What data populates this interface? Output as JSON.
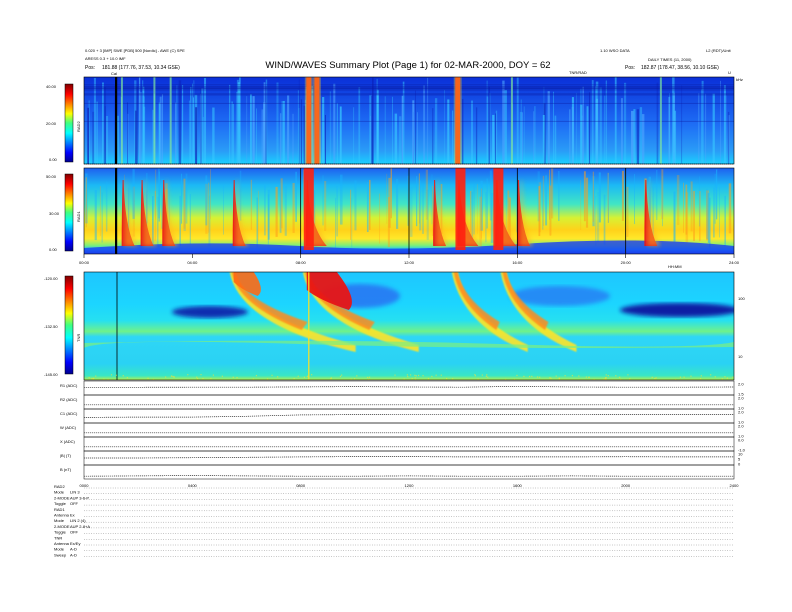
{
  "header": {
    "left_line1": "0.020 + 3 [IMP] SWE [PDB] 500 [Nordic] - AWE (C) SPE",
    "left_line2": "ARESS 0.3 + 10.0 IMF",
    "left_pos_label": "Pos:",
    "left_pos_value": "181.88 (177.76, 37.53, 10.34 GSE)",
    "title": "WIND/WAVES Summary Plot (Page 1) for 02-MAR-2000, DOY = 62",
    "right_line1": "1.10 WSO DATA",
    "right_line1b": "L2 (RDT)/Unit",
    "right_line2": "DAILY TIMES (11, 2000)",
    "right_pos_label": "Pos:",
    "right_pos_value": "182.87 (178.47, 38.56, 10.10 GSE)",
    "cal_label": "Cal",
    "tnr_top_label": "TNR/RAD"
  },
  "chart_data": [
    {
      "type": "heatmap",
      "panel": "RAD2",
      "ylabel": "RAD2",
      "y_ticks": [
        "40.00",
        "20.00",
        "0.00"
      ],
      "ylim": [
        0,
        40
      ],
      "right_label": "kHz",
      "right_top_label": "U",
      "color_scale": "jet",
      "xlim": [
        0,
        24
      ],
      "events_hours": [
        1.4,
        2.6,
        3.2,
        8.3,
        8.6,
        13.8,
        15.8,
        21.3
      ]
    },
    {
      "type": "heatmap",
      "panel": "RAD1",
      "ylabel": "RAD1",
      "y_ticks": [
        "50.00",
        "30.00",
        "0.00"
      ],
      "ylim": [
        0,
        50
      ],
      "color_scale": "jet",
      "xlim": [
        0,
        24
      ],
      "x_ticks": [
        "00:00",
        "04:00",
        "08:00",
        "12:00",
        "16:00",
        "20:00",
        "24:00"
      ],
      "x_axis_right_label": "HH:MM",
      "events_hours": [
        1.5,
        2.2,
        3.0,
        5.6,
        8.3,
        13.0,
        13.9,
        15.3,
        16.1,
        20.8
      ]
    },
    {
      "type": "heatmap",
      "panel": "TNR",
      "ylabel": "TNR",
      "y_ticks": [
        "-120.00",
        "-132.50",
        "-145.00"
      ],
      "ylim": [
        -145,
        -120
      ],
      "right_ticks": [
        "100",
        "10"
      ],
      "color_scale": "jet",
      "xlim": [
        0,
        24
      ],
      "events_hours": [
        5.6,
        8.3,
        13.8,
        15.6
      ]
    },
    {
      "type": "line",
      "panel": "stack",
      "series": [
        {
          "name": "R1 (ADC)",
          "ticks": [
            "2.0",
            "1.5"
          ],
          "values": [
            0.55,
            0.55,
            0.56,
            0.56,
            0.58,
            0.6,
            0.57,
            0.56,
            0.62,
            0.57,
            0.56,
            0.56,
            0.57
          ]
        },
        {
          "name": "R2 (ADC)",
          "ticks": [
            "2.0",
            "1.0"
          ],
          "values": [
            0.3,
            0.3,
            0.3,
            0.3,
            0.3,
            0.3,
            0.3,
            0.3,
            0.3,
            0.3,
            0.3,
            0.3,
            0.3
          ]
        },
        {
          "name": "C1 (ADC)",
          "ticks": [
            "2.0",
            "1.0"
          ],
          "values": [
            0.4,
            0.42,
            0.42,
            0.48,
            0.58,
            0.6,
            0.59,
            0.59,
            0.6,
            0.59,
            0.6,
            0.6,
            0.6
          ]
        },
        {
          "name": "W (ADC)",
          "ticks": [
            "2.0",
            "1.0"
          ],
          "values": [
            0.3,
            0.3,
            0.3,
            0.3,
            0.3,
            0.3,
            0.3,
            0.3,
            0.3,
            0.3,
            0.3,
            0.3,
            0.3
          ]
        },
        {
          "name": "X (ADC)",
          "ticks": [
            "0.0",
            "-1.0"
          ],
          "values": [
            0.3,
            0.3,
            0.3,
            0.3,
            0.3,
            0.3,
            0.3,
            0.3,
            0.3,
            0.3,
            0.3,
            0.3,
            0.3
          ]
        },
        {
          "name": "|B| (T)",
          "ticks": [
            "10",
            "5",
            "0"
          ],
          "values": [
            0.5,
            0.5,
            0.52,
            0.55,
            0.58,
            0.6,
            0.6,
            0.58,
            0.58,
            0.58,
            0.59,
            0.58,
            0.58
          ]
        },
        {
          "name": "B (nT)",
          "ticks": [],
          "values": [
            0.2,
            0.22,
            0.25,
            0.22,
            0.2,
            0.2,
            0.22,
            0.2,
            0.2,
            0.22,
            0.2,
            0.2,
            0.2
          ]
        }
      ],
      "x_ticks": [
        "0000",
        "0400",
        "0800",
        "1200",
        "1600",
        "2000",
        "2400"
      ]
    }
  ],
  "info_block": [
    {
      "label": "RAD2",
      "value": ""
    },
    {
      "label": "Mode",
      "value": "LIN 3"
    },
    {
      "label": "2-MODE",
      "value": "AUP 3-6-P"
    },
    {
      "label": "Toggle",
      "value": "OFF"
    },
    {
      "label": "RAD1",
      "value": ""
    },
    {
      "label": "Antenna",
      "value": "Ex"
    },
    {
      "label": "Mode",
      "value": "LIN 2 (4)"
    },
    {
      "label": "2-MODE",
      "value": "AUP 2-8+A"
    },
    {
      "label": "Toggle",
      "value": "OFF"
    },
    {
      "label": "TNR",
      "value": ""
    },
    {
      "label": "Antenna",
      "value": "Ex/Ey"
    },
    {
      "label": "Mode",
      "value": "A-D"
    },
    {
      "label": "Sweep",
      "value": "A-D"
    }
  ],
  "colors": {
    "frame": "#000000",
    "dotted": "#555555"
  }
}
